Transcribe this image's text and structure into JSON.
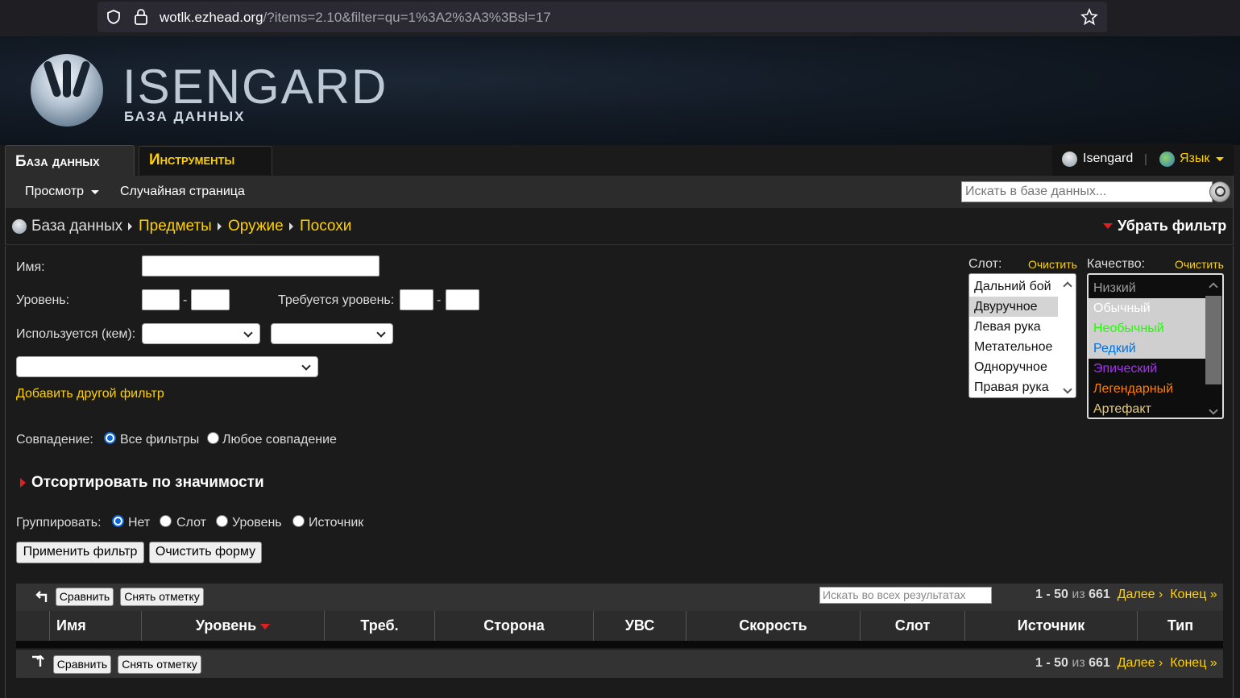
{
  "browser": {
    "host": "wotlk.ezhead.org",
    "path": "/?items=2.10&filter=qu=1%3A2%3A3%3Bsl=17"
  },
  "logo": {
    "title": "ISENGARD",
    "subtitle": "БАЗА ДАННЫХ"
  },
  "tabs": {
    "database": "База данных",
    "tools": "Инструменты"
  },
  "user": {
    "name": "Isengard",
    "language": "Язык"
  },
  "menu": {
    "browse": "Просмотр",
    "random": "Случайная страница",
    "search_placeholder": "Искать в базе данных..."
  },
  "breadcrumb": {
    "root": "База данных",
    "items": [
      "Предметы",
      "Оружие",
      "Посохи"
    ],
    "remove_filter": "Убрать фильтр"
  },
  "filter": {
    "name_label": "Имя:",
    "level_label": "Уровень:",
    "dash": "-",
    "req_level_label": "Требуется уровень:",
    "used_by_label": "Используется (кем):",
    "add_filter": "Добавить другой фильтр",
    "match_label": "Совпадение:",
    "match_all": "Все фильтры",
    "match_any": "Любое совпадение",
    "sort_title": "Отсортировать по значимости",
    "group_label": "Группировать:",
    "group_options": [
      "Нет",
      "Слот",
      "Уровень",
      "Источник"
    ],
    "apply": "Применить фильтр",
    "clear_form": "Очистить форму"
  },
  "slot": {
    "label": "Слот:",
    "clear": "Очистить",
    "options": [
      "Дальний бой",
      "Двуручное",
      "Левая рука",
      "Метательное",
      "Одноручное",
      "Правая рука"
    ],
    "selected_index": 1
  },
  "quality": {
    "label": "Качество:",
    "clear": "Очистить",
    "options": [
      {
        "label": "Низкий",
        "color": "#9d9d9d"
      },
      {
        "label": "Обычный",
        "color": "#ffffff"
      },
      {
        "label": "Необычный",
        "color": "#1eff00"
      },
      {
        "label": "Редкий",
        "color": "#0070dd"
      },
      {
        "label": "Эпический",
        "color": "#a335ee"
      },
      {
        "label": "Легендарный",
        "color": "#ff8000"
      },
      {
        "label": "Артефакт",
        "color": "#e6cc80"
      }
    ],
    "selected": [
      1,
      2,
      3
    ]
  },
  "results": {
    "compare": "Сравнить",
    "uncheck": "Снять отметку",
    "search_placeholder": "Искать во всех результатах",
    "range": "1 - 50",
    "of": "из",
    "total": "661",
    "next": "Далее ›",
    "last": "Конец »",
    "columns": [
      "Имя",
      "Уровень",
      "Треб.",
      "Сторона",
      "УВС",
      "Скорость",
      "Слот",
      "Источник",
      "Тип"
    ]
  }
}
